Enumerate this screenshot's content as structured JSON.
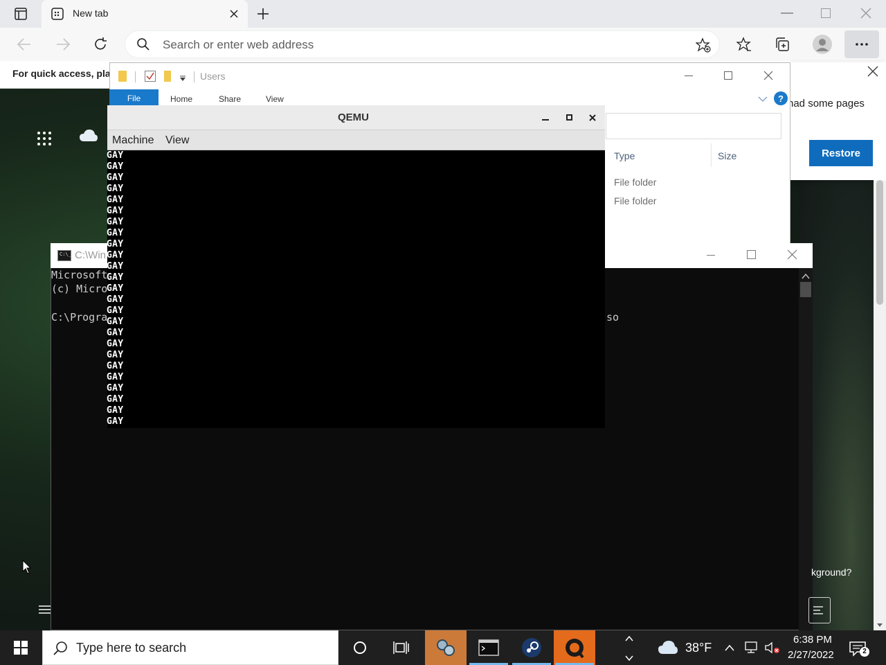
{
  "browser": {
    "tab_title": "New tab",
    "address_placeholder": "Search or enter web address",
    "info_text": "For quick access, plac"
  },
  "popup": {
    "partial_text": "had some pages",
    "restore_label": "Restore",
    "partial_bottom": "kground?"
  },
  "explorer": {
    "path": "Users",
    "ribbon_tabs": [
      "File",
      "Home",
      "Share",
      "View"
    ],
    "columns": [
      "Type",
      "Size"
    ],
    "rows": [
      "File folder",
      "File folder"
    ]
  },
  "console": {
    "title": "C:\\Win",
    "lines": [
      "Microsoft",
      "(c) Micro",
      "",
      "C:\\Progra"
    ],
    "tail_text": "so"
  },
  "qemu": {
    "title": "QEMU",
    "menu": [
      "Machine",
      "View"
    ],
    "output": [
      "GAY",
      "GAY",
      "GAY",
      "GAY",
      "GAY",
      "GAY",
      "GAY",
      "GAY",
      "GAY",
      "GAY",
      "GAY",
      "GAY",
      "GAY",
      "GAY",
      "GAY",
      "GAY",
      "GAY",
      "GAY",
      "GAY",
      "GAY",
      "GAY",
      "GAY",
      "GAY",
      "GAY",
      "GAY"
    ]
  },
  "taskbar": {
    "search_placeholder": "Type here to search",
    "weather_temp": "38°F",
    "time": "6:38 PM",
    "date": "2/27/2022",
    "notification_count": "2"
  },
  "colors": {
    "accent": "#0f6cbd",
    "file_tab": "#1979ca",
    "taskbar": "#1f1f1f",
    "qemu_screen": "#000000"
  },
  "icons": [
    "tab-actions-icon",
    "new-tab-icon",
    "back-icon",
    "forward-icon",
    "refresh-icon",
    "search-icon",
    "add-favorite-icon",
    "favorites-icon",
    "collections-icon",
    "profile-icon",
    "more-icon",
    "close-icon",
    "apps-grid-icon",
    "cloud-icon",
    "windows-start-icon",
    "cortana-icon",
    "task-view-icon",
    "steam-icon",
    "qemu-icon",
    "terminal-icon",
    "network-icon",
    "volume-muted-icon",
    "notification-icon"
  ]
}
